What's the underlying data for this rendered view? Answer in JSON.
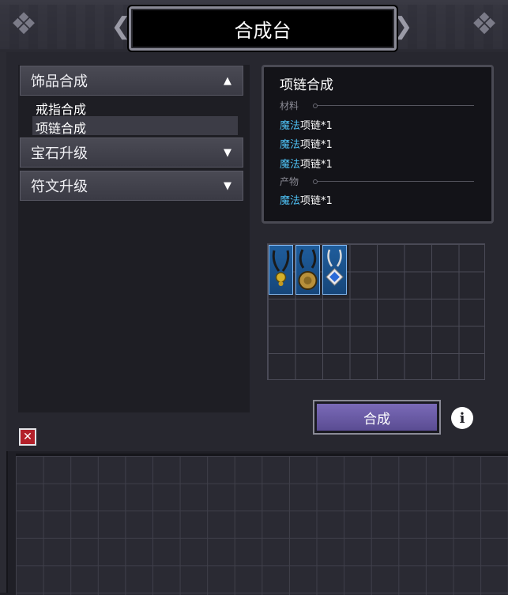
{
  "window": {
    "title": "合成台"
  },
  "categories": [
    {
      "label": "饰品合成",
      "arrow": "▲",
      "subitems": [
        "戒指合成",
        "项链合成"
      ]
    },
    {
      "label": "宝石升级",
      "arrow": "▼"
    },
    {
      "label": "符文升级",
      "arrow": "▼"
    }
  ],
  "recipe": {
    "title": "项链合成",
    "materials_label": "材料",
    "materials": [
      {
        "prefix": "魔法",
        "name": "项链*1"
      },
      {
        "prefix": "魔法",
        "name": "项链*1"
      },
      {
        "prefix": "魔法",
        "name": "项链*1"
      }
    ],
    "product_label": "产物",
    "product": {
      "prefix": "魔法",
      "name": "项链*1"
    }
  },
  "actions": {
    "craft_label": "合成",
    "info_symbol": "i",
    "close_symbol": "✕"
  },
  "colors": {
    "highlight": "#4fc3f7",
    "button": "#6b5ca8",
    "close": "#b3202a"
  }
}
